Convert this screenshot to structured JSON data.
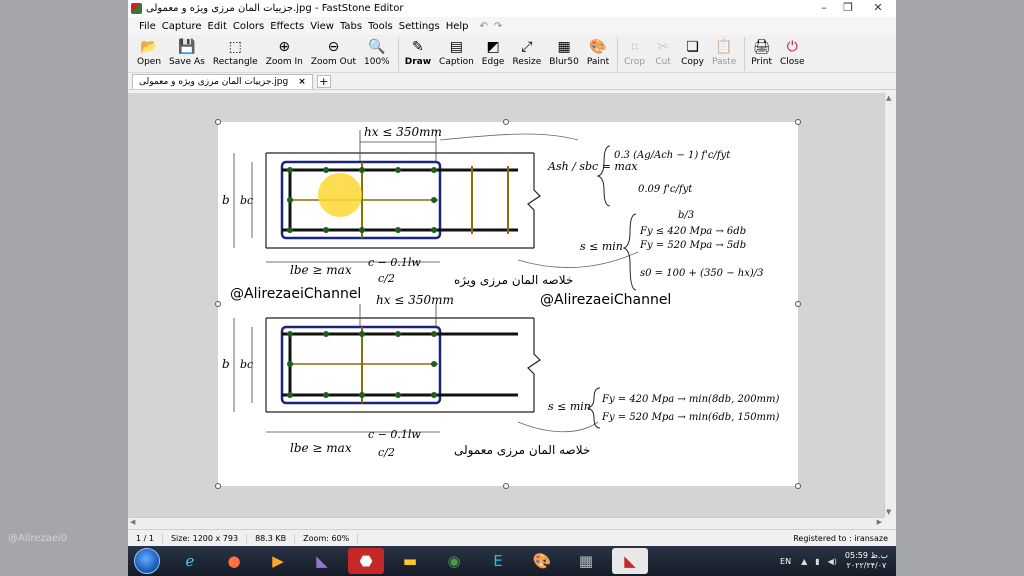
{
  "window": {
    "title": "جزییات المان مرزی ویژه و معمولی.jpg - FastStone Editor",
    "controls": {
      "minimize": "–",
      "restore": "❐",
      "close": "✕"
    }
  },
  "menu": [
    "File",
    "Capture",
    "Edit",
    "Colors",
    "Effects",
    "View",
    "Tabs",
    "Tools",
    "Settings",
    "Help"
  ],
  "toolbar": [
    {
      "label": "Open",
      "icon": "📂"
    },
    {
      "label": "Save As",
      "icon": "💾"
    },
    {
      "label": "Rectangle",
      "icon": "⬚"
    },
    {
      "label": "Zoom In",
      "icon": "⊕"
    },
    {
      "label": "Zoom Out",
      "icon": "⊖"
    },
    {
      "label": "100%",
      "icon": "🔍"
    },
    {
      "label": "Draw",
      "icon": "✎"
    },
    {
      "label": "Caption",
      "icon": "▤"
    },
    {
      "label": "Edge",
      "icon": "◩"
    },
    {
      "label": "Resize",
      "icon": "⤢"
    },
    {
      "label": "Blur50",
      "icon": "▦"
    },
    {
      "label": "Paint",
      "icon": "🎨"
    },
    {
      "label": "Crop",
      "icon": "⌗"
    },
    {
      "label": "Cut",
      "icon": "✂"
    },
    {
      "label": "Copy",
      "icon": "❏"
    },
    {
      "label": "Paste",
      "icon": "📋"
    },
    {
      "label": "Print",
      "icon": "🖨"
    },
    {
      "label": "Close",
      "icon": "⏻"
    }
  ],
  "tabs": [
    {
      "label": "جزییات المان مرزی ویژه و معمولی.jpg"
    }
  ],
  "status": {
    "page": "1 / 1",
    "size": "Size: 1200 x 793",
    "filesize": "88.3 KB",
    "zoom": "Zoom: 60%",
    "registered": "Registered to : iransaze"
  },
  "document": {
    "hx_top": "hx ≤ 350mm",
    "hx_mid": "hx ≤ 350mm",
    "b": "b",
    "bc": "bc",
    "lbe": "lbe ≥ max",
    "lbe_opt1": "c − 0.1lw",
    "lbe_opt2": "c/2",
    "caption_special": "خلاصه المان مرزی ویژه",
    "caption_ordinary": "خلاصه المان مرزی معمولی",
    "channel1": "@AlirezaeiChannel",
    "channel2": "@AlirezaeiChannel",
    "ash_lhs": "Ash / sbc = max",
    "ash_f1": "0.3 (Ag/Ach − 1) f'c/fyt",
    "ash_f2": "0.09 f'c/fyt",
    "s_min": "s ≤ min",
    "s1": "b/3",
    "s2": "Fy ≤ 420 Mpa → 6db",
    "s3": "Fy = 520 Mpa → 5db",
    "s4": "s0 = 100 + (350 − hx)/3",
    "s_min2": "s ≤ min",
    "o1": "Fy = 420 Mpa → min(8db, 200mm)",
    "o2": "Fy = 520 Mpa → min(6db, 150mm)"
  },
  "taskbar": {
    "lang": "EN",
    "time": "05:59 ب.ظ",
    "date": "۲۰۲۲/۲۴/۰۷",
    "watermark": "@Alirezaei0"
  }
}
